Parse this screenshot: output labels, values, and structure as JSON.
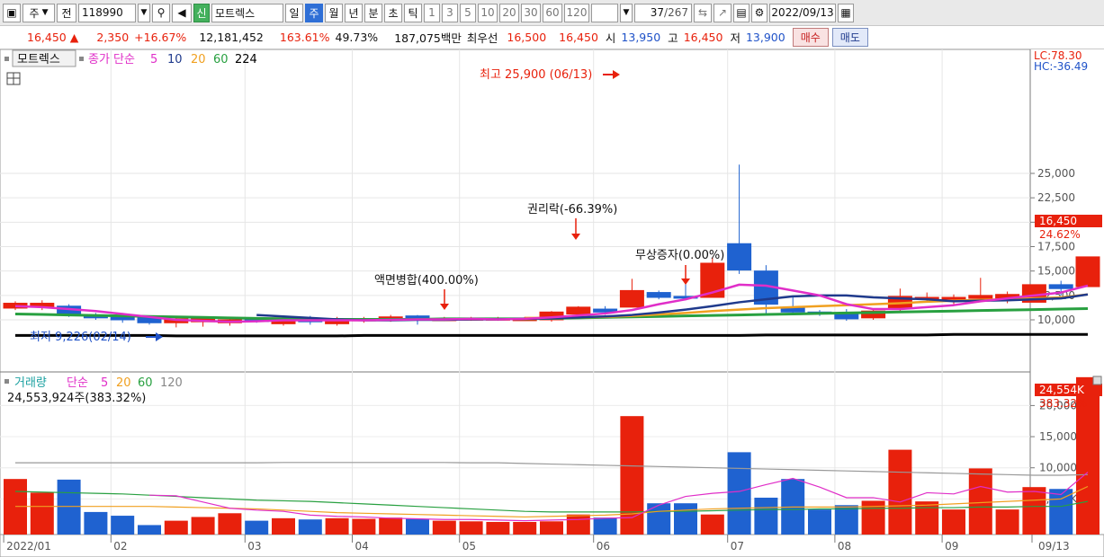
{
  "toolbar": {
    "market": "주",
    "period_label": "전",
    "code": "118990",
    "name": "모트렉스",
    "credit_badge": "신",
    "periods": [
      "일",
      "주",
      "월",
      "년"
    ],
    "active_period": "주",
    "intraday": [
      "분",
      "초",
      "틱"
    ],
    "counts": [
      "1",
      "3",
      "5",
      "10",
      "20",
      "30",
      "60",
      "120"
    ],
    "range_value": "37",
    "range_total": "/267",
    "date": "2022/09/13"
  },
  "quote": {
    "price": "16,450",
    "arrow": "▲",
    "change": "2,350",
    "change_pct": "+16.67%",
    "volume": "12,181,452",
    "vol_ratio": "163.61%",
    "turnover": "49.73%",
    "amount": "187,075백만",
    "best_label": "최우선",
    "best_ask": "16,500",
    "best_bid": "16,450",
    "open_label": "시",
    "open": "13,950",
    "high_label": "고",
    "high": "16,450",
    "low_label": "저",
    "low": "13,900",
    "buy": "매수",
    "sell": "매도"
  },
  "price_legend": {
    "stock": "모트렉스",
    "ma_label": "종가 단순",
    "ma": [
      {
        "label": "5",
        "color": "#e02ec8"
      },
      {
        "label": "10",
        "color": "#1f3a8c"
      },
      {
        "label": "20",
        "color": "#f0a020"
      },
      {
        "label": "60",
        "color": "#28a040"
      },
      {
        "label": "224",
        "color": "#000000"
      }
    ]
  },
  "volume_legend": {
    "label": "거래량",
    "ma_label": "단순",
    "ma": [
      {
        "label": "5",
        "color": "#e02ec8"
      },
      {
        "label": "20",
        "color": "#f0a020"
      },
      {
        "label": "60",
        "color": "#28a040"
      },
      {
        "label": "120",
        "color": "#888888"
      }
    ],
    "current": "24,553,924주(383.32%)"
  },
  "annotations": {
    "high": "최고 25,900 (06/13)",
    "low": "최저 9,226(02/14)",
    "split": "액면병합(400.00%)",
    "rights": "권리락(-66.39%)",
    "bonus": "무상증자(0.00%)"
  },
  "right_axis": {
    "lc": "LC:78.30",
    "hc": "HC:-36.49",
    "price_badge": "16,450",
    "price_pct": "24.62%",
    "vol_badge": "24,554K",
    "vol_pct": "383.32%"
  },
  "chart_data": {
    "type": "candlestick",
    "price_ticks": [
      "25,000",
      "22,500",
      "20,000",
      "17,500",
      "15,000",
      "12,500",
      "10,000"
    ],
    "price_tick_values": [
      25000,
      22500,
      20000,
      17500,
      15000,
      12500,
      10000
    ],
    "volume_ticks": [
      "20,000K",
      "15,000K",
      "10,000K",
      "5,000K"
    ],
    "volume_tick_values": [
      20000,
      15000,
      10000,
      5000
    ],
    "date_labels": [
      "2022/01",
      "02",
      "03",
      "04",
      "05",
      "06",
      "07",
      "08",
      "09",
      "09/13"
    ],
    "candles": [
      {
        "o": 11200,
        "c": 11700,
        "h": 11900,
        "l": 11000,
        "v": 8200
      },
      {
        "o": 11300,
        "c": 11700,
        "h": 12000,
        "l": 11000,
        "v": 6000
      },
      {
        "o": 11400,
        "c": 10500,
        "h": 11600,
        "l": 10300,
        "v": 8100
      },
      {
        "o": 10400,
        "c": 10200,
        "h": 10700,
        "l": 10000,
        "v": 2900
      },
      {
        "o": 10400,
        "c": 10000,
        "h": 10700,
        "l": 9700,
        "v": 2300
      },
      {
        "o": 10200,
        "c": 9700,
        "h": 10400,
        "l": 9500,
        "v": 800
      },
      {
        "o": 9700,
        "c": 10100,
        "h": 10300,
        "l": 9226,
        "v": 1500
      },
      {
        "o": 9800,
        "c": 10100,
        "h": 10300,
        "l": 9300,
        "v": 2100
      },
      {
        "o": 9700,
        "c": 10000,
        "h": 10300,
        "l": 9400,
        "v": 2700
      },
      {
        "o": 10000,
        "c": 9900,
        "h": 10200,
        "l": 9700,
        "v": 1500
      },
      {
        "o": 9600,
        "c": 10200,
        "h": 10400,
        "l": 9400,
        "v": 1900
      },
      {
        "o": 10100,
        "c": 9800,
        "h": 10400,
        "l": 9500,
        "v": 1700
      },
      {
        "o": 9600,
        "c": 10100,
        "h": 10300,
        "l": 9400,
        "v": 1900
      },
      {
        "o": 9900,
        "c": 10100,
        "h": 10300,
        "l": 9700,
        "v": 1800
      },
      {
        "o": 10000,
        "c": 10300,
        "h": 10500,
        "l": 9800,
        "v": 2000
      },
      {
        "o": 10400,
        "c": 10000,
        "h": 10500,
        "l": 9500,
        "v": 1800
      },
      {
        "o": 10100,
        "c": 10100,
        "h": 10300,
        "l": 9900,
        "v": 1500
      },
      {
        "o": 10100,
        "c": 10150,
        "h": 10300,
        "l": 9900,
        "v": 1400
      },
      {
        "o": 10100,
        "c": 10150,
        "h": 10300,
        "l": 9900,
        "v": 1300
      },
      {
        "o": 10000,
        "c": 10100,
        "h": 10300,
        "l": 9900,
        "v": 1300
      },
      {
        "o": 10000,
        "c": 10800,
        "h": 10900,
        "l": 9800,
        "v": 1400
      },
      {
        "o": 10600,
        "c": 11300,
        "h": 11400,
        "l": 10300,
        "v": 2500
      },
      {
        "o": 11100,
        "c": 10800,
        "h": 11400,
        "l": 10500,
        "v": 2000
      },
      {
        "o": 11300,
        "c": 13000,
        "h": 14200,
        "l": 11300,
        "v": 18300
      },
      {
        "o": 12800,
        "c": 12300,
        "h": 13000,
        "l": 12100,
        "v": 4300
      },
      {
        "o": 12400,
        "c": 12300,
        "h": 15500,
        "l": 12000,
        "v": 4300
      },
      {
        "o": 12300,
        "c": 15800,
        "h": 16400,
        "l": 12300,
        "v": 2500
      },
      {
        "o": 17800,
        "c": 15100,
        "h": 25900,
        "l": 14700,
        "v": 12500
      },
      {
        "o": 15000,
        "c": 11600,
        "h": 15600,
        "l": 10600,
        "v": 5200
      },
      {
        "o": 11200,
        "c": 10800,
        "h": 12400,
        "l": 10600,
        "v": 8200
      },
      {
        "o": 10800,
        "c": 10700,
        "h": 11000,
        "l": 10400,
        "v": 3300
      },
      {
        "o": 10700,
        "c": 10100,
        "h": 11100,
        "l": 9900,
        "v": 4000
      },
      {
        "o": 10200,
        "c": 10900,
        "h": 11100,
        "l": 10000,
        "v": 4700
      },
      {
        "o": 11200,
        "c": 12400,
        "h": 13200,
        "l": 10800,
        "v": 12900
      },
      {
        "o": 12300,
        "c": 12300,
        "h": 12800,
        "l": 11800,
        "v": 4600
      },
      {
        "o": 12300,
        "c": 12300,
        "h": 12600,
        "l": 11600,
        "v": 3300
      },
      {
        "o": 12200,
        "c": 12500,
        "h": 14300,
        "l": 11900,
        "v": 9900
      },
      {
        "o": 12200,
        "c": 12600,
        "h": 12900,
        "l": 11700,
        "v": 3300
      },
      {
        "o": 11800,
        "c": 13600,
        "h": 13600,
        "l": 11800,
        "v": 6900
      },
      {
        "o": 13600,
        "c": 13200,
        "h": 14000,
        "l": 12500,
        "v": 6600
      },
      {
        "o": 13400,
        "c": 16450,
        "h": 16450,
        "l": 13400,
        "v": 24554
      }
    ],
    "ma5": [
      11400,
      11300,
      11100,
      10900,
      10600,
      10300,
      10000,
      9900,
      9800,
      9850,
      9950,
      9950,
      9950,
      9950,
      10000,
      10050,
      10050,
      10100,
      10050,
      10100,
      10250,
      10450,
      10650,
      11000,
      11600,
      12100,
      12800,
      13600,
      13500,
      13000,
      12500,
      11600,
      11100,
      11100,
      11300,
      11500,
      11900,
      12200,
      12500,
      12800,
      13500
    ],
    "ma10": [
      null,
      null,
      null,
      null,
      null,
      null,
      null,
      null,
      null,
      10500,
      10350,
      10200,
      10050,
      9950,
      9950,
      10000,
      10000,
      10050,
      10050,
      10100,
      10150,
      10250,
      10350,
      10500,
      10750,
      11050,
      11400,
      11800,
      12100,
      12400,
      12500,
      12500,
      12300,
      12200,
      12100,
      11900,
      11950,
      12000,
      12100,
      12200,
      12600
    ],
    "ma20": [
      null,
      null,
      null,
      null,
      null,
      null,
      null,
      null,
      null,
      null,
      null,
      null,
      null,
      null,
      null,
      null,
      null,
      null,
      null,
      10200,
      10200,
      10250,
      10300,
      10400,
      10550,
      10700,
      10900,
      11050,
      11200,
      11300,
      11400,
      11500,
      11600,
      11700,
      11850,
      11950,
      12050,
      12100,
      12200,
      12300,
      12600
    ],
    "ma60": [
      10600,
      10550,
      10500,
      10450,
      10400,
      10350,
      10300,
      10250,
      10200,
      10150,
      10100,
      10050,
      10050,
      10050,
      10050,
      10050,
      10100,
      10100,
      10100,
      10100,
      10150,
      10200,
      10250,
      10300,
      10350,
      10400,
      10450,
      10500,
      10550,
      10600,
      10650,
      10700,
      10750,
      10800,
      10850,
      10900,
      10950,
      11000,
      11050,
      11100,
      11150
    ],
    "ma224": [
      8400,
      8400,
      8400,
      8400,
      8400,
      8400,
      8350,
      8350,
      8350,
      8350,
      8350,
      8350,
      8350,
      8400,
      8400,
      8400,
      8400,
      8400,
      8400,
      8400,
      8400,
      8400,
      8400,
      8400,
      8400,
      8400,
      8400,
      8400,
      8450,
      8450,
      8450,
      8450,
      8450,
      8450,
      8450,
      8500,
      8500,
      8500,
      8500,
      8500,
      8500
    ],
    "vma5": [
      null,
      null,
      null,
      null,
      null,
      5600,
      5500,
      4500,
      3500,
      3200,
      3000,
      2400,
      2200,
      2100,
      1900,
      1800,
      1700,
      1700,
      1600,
      1500,
      1600,
      1700,
      1900,
      2000,
      4000,
      5400,
      5900,
      6200,
      7300,
      8300,
      6900,
      5200,
      5200,
      4500,
      6000,
      5800,
      7000,
      6100,
      6200,
      5700,
      9300
    ],
    "vma20": [
      3800,
      3800,
      3800,
      3800,
      3800,
      3800,
      3700,
      3600,
      3500,
      3400,
      3200,
      3000,
      2800,
      2700,
      2600,
      2500,
      2400,
      2300,
      2200,
      2100,
      2200,
      2300,
      2400,
      2600,
      3000,
      3200,
      3400,
      3500,
      3600,
      3700,
      3700,
      3700,
      3800,
      3900,
      4000,
      4200,
      4400,
      4600,
      4800,
      5000,
      7000
    ],
    "vma60": [
      6200,
      6100,
      6000,
      5900,
      5800,
      5600,
      5400,
      5200,
      5000,
      4800,
      4700,
      4600,
      4400,
      4200,
      4000,
      3800,
      3600,
      3400,
      3200,
      3000,
      2900,
      2900,
      2900,
      2900,
      3000,
      3000,
      3100,
      3200,
      3300,
      3300,
      3400,
      3400,
      3500,
      3500,
      3600,
      3600,
      3700,
      3700,
      3800,
      3800,
      4600
    ],
    "vma120": [
      10800,
      10800,
      10800,
      10800,
      10800,
      10800,
      10800,
      10800,
      10800,
      10800,
      10850,
      10850,
      10850,
      10850,
      10850,
      10850,
      10850,
      10800,
      10800,
      10700,
      10600,
      10500,
      10400,
      10300,
      10200,
      10100,
      10000,
      9900,
      9800,
      9700,
      9600,
      9500,
      9400,
      9300,
      9200,
      9100,
      9000,
      8900,
      8800,
      8800,
      8900
    ]
  }
}
